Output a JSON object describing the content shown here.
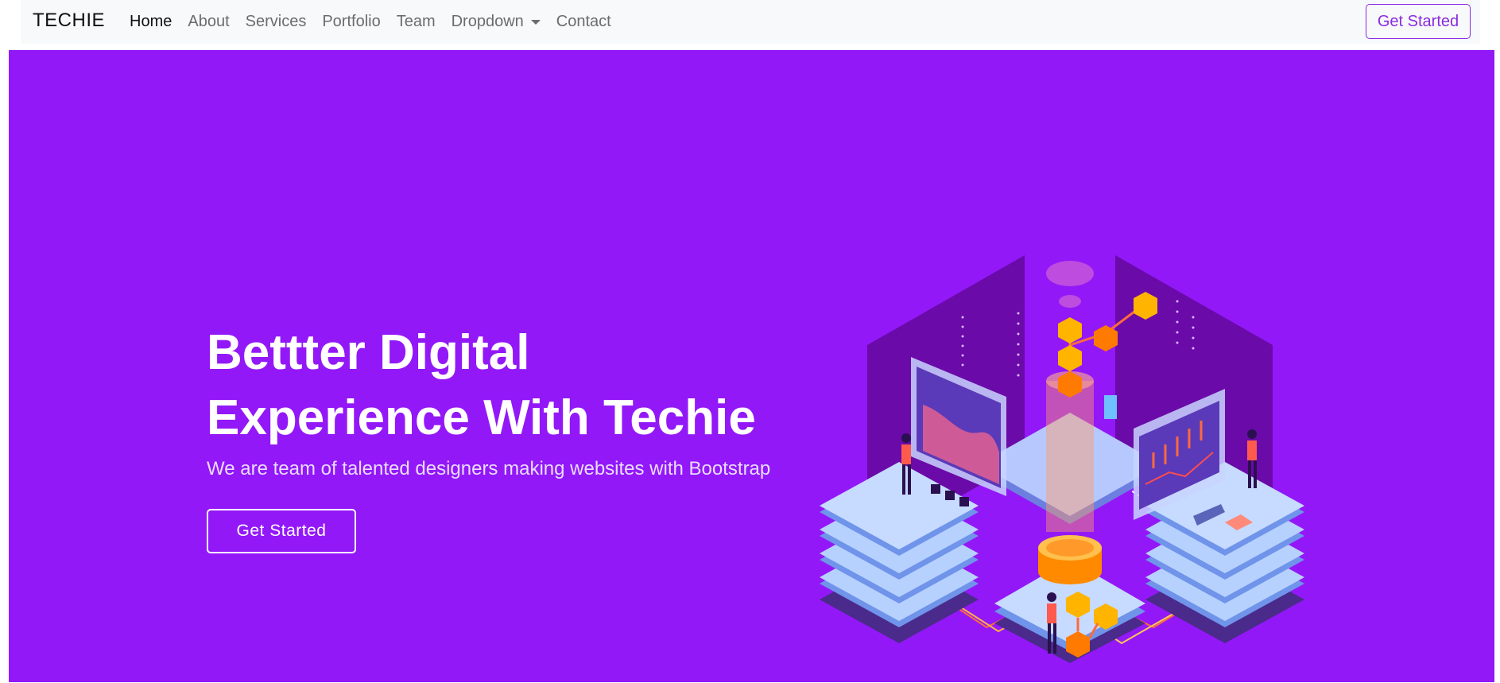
{
  "nav": {
    "brand": "TECHIE",
    "links": [
      {
        "label": "Home",
        "active": true
      },
      {
        "label": "About"
      },
      {
        "label": "Services"
      },
      {
        "label": "Portfolio"
      },
      {
        "label": "Team"
      },
      {
        "label": "Dropdown",
        "has_caret": true
      },
      {
        "label": "Contact"
      }
    ],
    "cta_label": "Get Started"
  },
  "hero": {
    "title_line1": "Bettter Digital",
    "title_line2": "Experience With Techie",
    "subtitle": "We are team of talented designers making websites with Bootstrap",
    "button_label": "Get Started"
  },
  "colors": {
    "hero_bg": "#9318f8",
    "accent": "#8a2be2",
    "navbar_bg": "#f8f9fa"
  }
}
